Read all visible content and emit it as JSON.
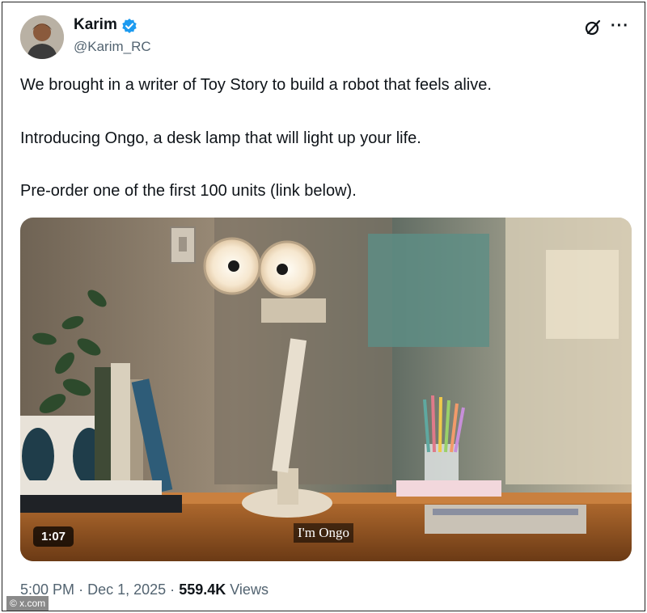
{
  "author": {
    "name": "Karim",
    "handle": "@Karim_RC",
    "verified_color": "#1d9bf0"
  },
  "tweet": {
    "lines": [
      "We brought in a writer of Toy Story to build a robot that feels alive.",
      "Introducing Ongo, a desk lamp that will light up your life.",
      "Pre-order one of the first 100 units (link below)."
    ]
  },
  "media": {
    "duration": "1:07",
    "caption": "I'm Ongo"
  },
  "meta": {
    "time": "5:00 PM",
    "date": "Dec 1, 2025",
    "views_count": "559.4K",
    "views_label": "Views",
    "separator": "·"
  },
  "watermark": "© x.com",
  "icons": {
    "grok": "grok-icon",
    "more": "more-icon"
  }
}
